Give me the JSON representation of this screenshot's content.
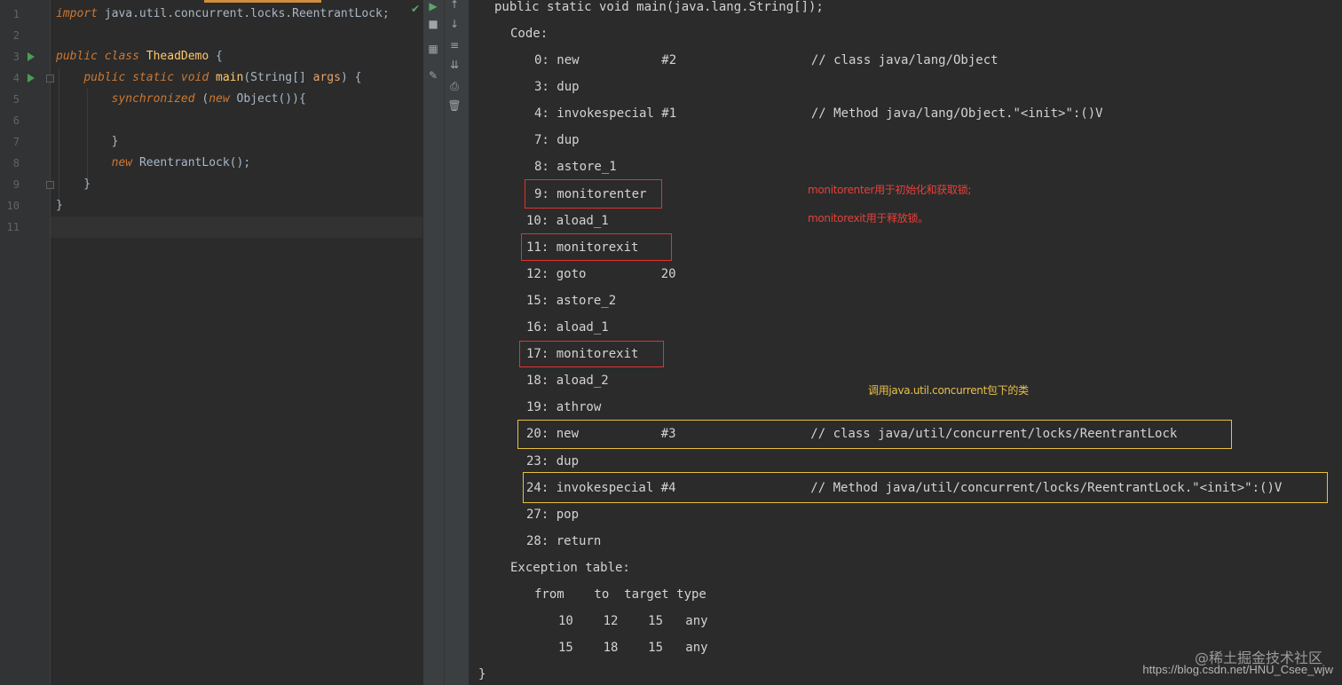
{
  "editor": {
    "line_numbers": [
      "1",
      "2",
      "3",
      "4",
      "5",
      "6",
      "7",
      "8",
      "9",
      "10",
      "11"
    ],
    "lines": [
      [
        {
          "t": "import",
          "c": "kw"
        },
        {
          "t": " java.util.concurrent.locks.ReentrantLock;",
          "c": "plain"
        }
      ],
      [],
      [
        {
          "t": "public ",
          "c": "kw"
        },
        {
          "t": "class ",
          "c": "kw"
        },
        {
          "t": "TheadDemo",
          "c": "cls"
        },
        {
          "t": " {",
          "c": "plain"
        }
      ],
      [
        {
          "t": "    ",
          "c": "plain"
        },
        {
          "t": "public static void ",
          "c": "kw"
        },
        {
          "t": "main",
          "c": "method"
        },
        {
          "t": "(String[] ",
          "c": "plain"
        },
        {
          "t": "args",
          "c": "param"
        },
        {
          "t": ") {",
          "c": "plain"
        }
      ],
      [
        {
          "t": "        ",
          "c": "plain"
        },
        {
          "t": "synchronized ",
          "c": "kw"
        },
        {
          "t": "(",
          "c": "plain"
        },
        {
          "t": "new ",
          "c": "kw"
        },
        {
          "t": "Object()){",
          "c": "plain"
        }
      ],
      [],
      [
        {
          "t": "        }",
          "c": "plain"
        }
      ],
      [
        {
          "t": "        ",
          "c": "plain"
        },
        {
          "t": "new ",
          "c": "kw"
        },
        {
          "t": "ReentrantLock();",
          "c": "plain"
        }
      ],
      [
        {
          "t": "    }",
          "c": "plain"
        }
      ],
      [
        {
          "t": "}",
          "c": "plain"
        }
      ],
      []
    ]
  },
  "toolbar": {
    "strip_a": [
      "run-icon",
      "stop-icon",
      "layout-icon",
      "pin-icon"
    ],
    "strip_b": [
      "up-arrow-icon",
      "down-arrow-icon",
      "soft-wrap-icon",
      "scroll-to-end-icon",
      "print-icon",
      "trash-icon"
    ]
  },
  "console": {
    "header": "public static void main(java.lang.String[]);",
    "code_label": "Code:",
    "instructions": [
      "0: new           #2                  // class java/lang/Object",
      "3: dup",
      "4: invokespecial #1                  // Method java/lang/Object.\"<init>\":()V",
      "7: dup",
      "8: astore_1",
      "9: monitorenter",
      "10: aload_1",
      "11: monitorexit",
      "12: goto          20",
      "15: astore_2",
      "16: aload_1",
      "17: monitorexit",
      "18: aload_2",
      "19: athrow",
      "20: new           #3                  // class java/util/concurrent/locks/ReentrantLock",
      "23: dup",
      "24: invokespecial #4                  // Method java/util/concurrent/locks/ReentrantLock.\"<init>\":()V",
      "27: pop",
      "28: return"
    ],
    "exception_label": "Exception table:",
    "exception_header": "from    to  target type",
    "exception_rows": [
      "10    12    15   any",
      "15    18    15   any"
    ],
    "closing_brace": "}",
    "notes": {
      "monitorenter": "monitorenter用于初始化和获取锁;",
      "monitorexit": "monitorexit用于释放锁。",
      "juc": "调用java.util.concurrent包下的类"
    },
    "colors": {
      "red_box": "#e2332f",
      "yellow_box": "#e9c03c"
    }
  },
  "watermark": {
    "brand": "@稀土掘金技术社区",
    "url": "https://blog.csdn.net/HNU_Csee_wjw"
  }
}
